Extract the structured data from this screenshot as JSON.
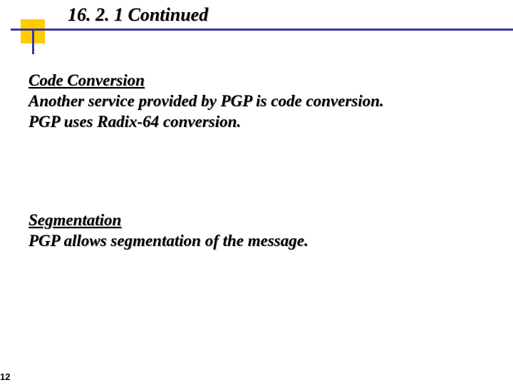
{
  "title": "16. 2. 1  Continued",
  "section1": {
    "heading": "Code Conversion",
    "line1": "Another service provided by PGP is code conversion.",
    "line2": "PGP uses Radix-64 conversion."
  },
  "section2": {
    "heading": "Segmentation",
    "line1": "PGP allows segmentation of the message."
  },
  "page_number": "12"
}
